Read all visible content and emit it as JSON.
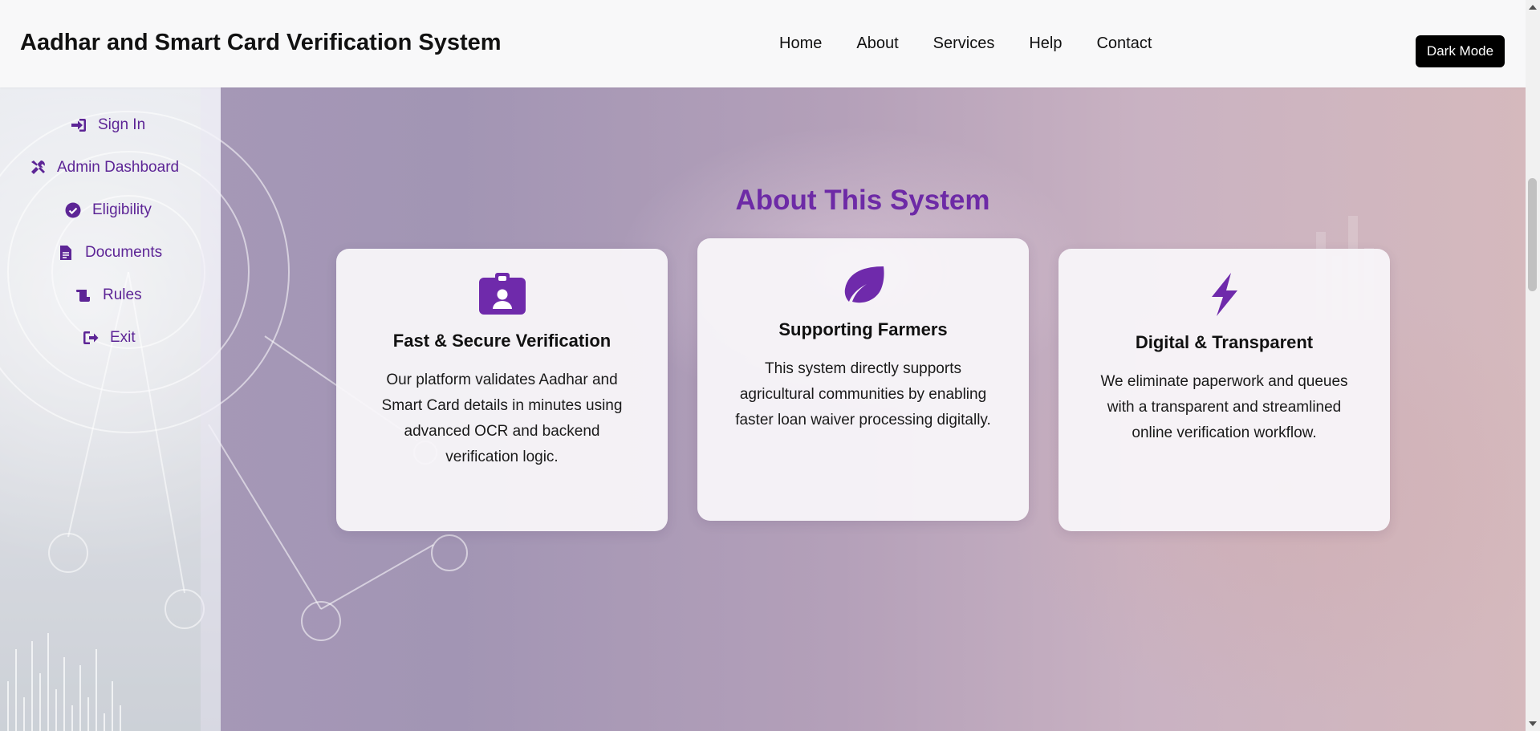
{
  "header": {
    "title": "Aadhar and Smart Card Verification System",
    "nav": [
      "Home",
      "About",
      "Services",
      "Help",
      "Contact"
    ],
    "dark_mode_label": "Dark Mode"
  },
  "sidebar": {
    "items": [
      {
        "label": "Sign In",
        "icon": "sign-in-icon"
      },
      {
        "label": "Admin Dashboard",
        "icon": "tools-icon"
      },
      {
        "label": "Eligibility",
        "icon": "check-circle-icon"
      },
      {
        "label": "Documents",
        "icon": "document-icon"
      },
      {
        "label": "Rules",
        "icon": "scroll-icon"
      },
      {
        "label": "Exit",
        "icon": "sign-out-icon"
      }
    ]
  },
  "about": {
    "title": "About This System",
    "cards": [
      {
        "icon": "id-badge-icon",
        "title": "Fast & Secure Verification",
        "text": "Our platform validates Aadhar and Smart Card details in minutes using advanced OCR and backend verification logic."
      },
      {
        "icon": "leaf-icon",
        "title": "Supporting Farmers",
        "text": "This system directly supports agricultural communities by enabling faster loan waiver processing digitally."
      },
      {
        "icon": "bolt-icon",
        "title": "Digital & Transparent",
        "text": "We eliminate paperwork and queues with a transparent and streamlined online verification workflow."
      }
    ]
  },
  "colors": {
    "accent": "#6f2aab",
    "sidebar_text": "#5d2596",
    "header_bg": "#f8f8f9",
    "button_bg": "#000000"
  }
}
